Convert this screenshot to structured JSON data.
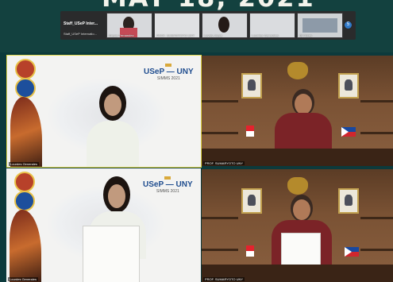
{
  "header": {
    "title": "MAY 18, 2021"
  },
  "strip": {
    "staff_name": "Staff_USeP Inter...",
    "staff_sub": "Staff_USeP Internatio...",
    "thumbs": [
      {
        "label": "Royce Fernandez"
      },
      {
        "label": "PROF. SUMARYOTO UNY"
      },
      {
        "label": "Lovely Joyce"
      },
      {
        "label": "Lourdes Generales"
      },
      {
        "label": "Rj Flores"
      }
    ],
    "overflow_count": "5"
  },
  "tiles": [
    {
      "banner_title": "USeP — UNY",
      "banner_sub": "SIMMS 2021",
      "name": "Lourdes Generales"
    },
    {
      "name": "PROF. SUMARYOTO UNY"
    },
    {
      "banner_title": "USeP — UNY",
      "banner_sub": "SIMMS 2021",
      "name": "Lourdes Generales"
    },
    {
      "name": "PROF. SUMARYOTO UNY"
    }
  ],
  "colors": {
    "accent": "#2f79c9",
    "speaker_border": "#e0d84a"
  }
}
